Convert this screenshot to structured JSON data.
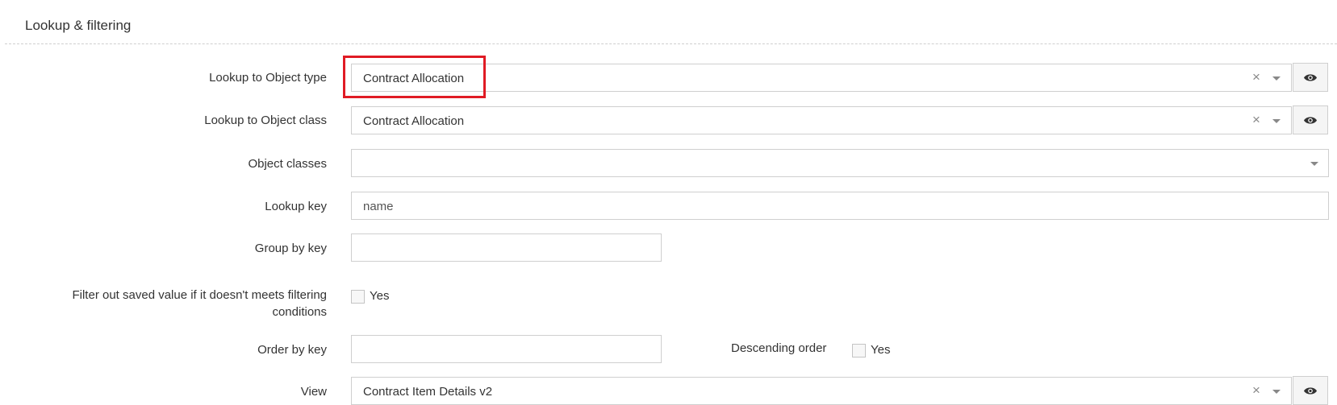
{
  "section": {
    "title": "Lookup & filtering"
  },
  "fields": {
    "lookup_object_type": {
      "label": "Lookup to Object type",
      "value": "Contract Allocation"
    },
    "lookup_object_class": {
      "label": "Lookup to Object class",
      "value": "Contract Allocation"
    },
    "object_classes": {
      "label": "Object classes",
      "value": ""
    },
    "lookup_key": {
      "label": "Lookup key",
      "placeholder": "name"
    },
    "group_by_key": {
      "label": "Group by key",
      "value": ""
    },
    "filter_saved": {
      "label_line1": "Filter out saved value if it doesn't meets filtering",
      "label_line2": "conditions",
      "checkbox_label": "Yes"
    },
    "order_by_key": {
      "label": "Order by key",
      "value": ""
    },
    "descending_order": {
      "label": "Descending order",
      "checkbox_label": "Yes"
    },
    "view": {
      "label": "View",
      "value": "Contract Item Details v2"
    }
  },
  "glyphs": {
    "clear": "×"
  },
  "colors": {
    "highlight": "#e01b24"
  }
}
